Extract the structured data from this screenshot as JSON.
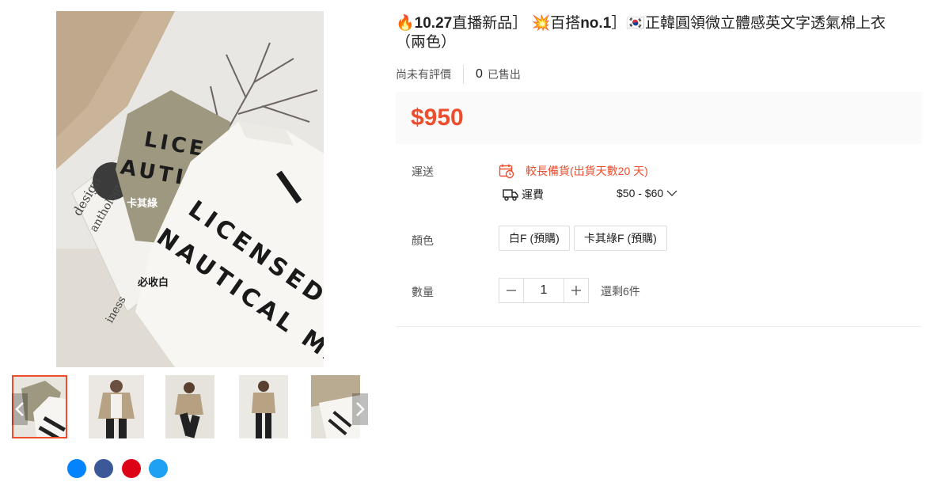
{
  "product": {
    "title_emoji1": "🔥",
    "title_part1": "10.27",
    "title_part2": "直播新品］",
    "title_emoji2": "💥",
    "title_part3": "百搭",
    "title_part4": "no.1",
    "title_part5": "］",
    "title_emoji3": "🇰🇷",
    "title_part6": "正韓圓領微立體感英文字透氣棉上衣（兩色）",
    "rating_text": "尚未有評價",
    "sold_count": "0",
    "sold_label": "已售出",
    "price": "$950"
  },
  "image": {
    "main_label_khaki": "卡其綠",
    "main_label_white": "必收白",
    "shirt_text_line1": "LICENSED",
    "shirt_text_line2": "NAUTICAL MA",
    "khaki_text_line1": "LICE",
    "khaki_text_line2": "AUTIC",
    "magazine_text1": "design",
    "magazine_text2": "anthology",
    "magazine_text3": "iness"
  },
  "shipping": {
    "label": "運送",
    "preorder_text": "較長備貨(出貨天數20 天)",
    "fee_label": "運費",
    "fee_range": "$50 - $60"
  },
  "variations": {
    "label": "顏色",
    "options": [
      "白F (預購)",
      "卡其綠F (預購)"
    ]
  },
  "quantity": {
    "label": "數量",
    "value": "1",
    "stock": "還剩6件"
  },
  "colors": {
    "accent": "#ee4d2d",
    "price_bg": "#fafafa"
  },
  "icons": [
    "chevron-left-icon",
    "chevron-right-icon",
    "calendar-clock-icon",
    "truck-icon",
    "chevron-down-icon",
    "minus-icon",
    "plus-icon"
  ]
}
